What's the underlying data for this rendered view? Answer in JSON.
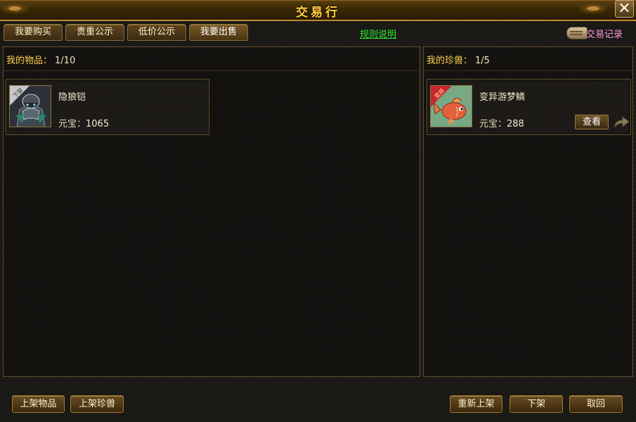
{
  "window": {
    "title": "交易行",
    "close_glyph": "✕"
  },
  "tabs": [
    {
      "label": "我要购买"
    },
    {
      "label": "贵重公示"
    },
    {
      "label": "低价公示"
    },
    {
      "label": "我要出售"
    }
  ],
  "rules_link": "规则说明",
  "trade_record": "交易记录",
  "left_panel": {
    "header_label": "我的物品：",
    "count": "1/10",
    "items": [
      {
        "name": "隐狼铠",
        "price_label": "元宝：",
        "price": "1065",
        "icon": "armor-icon",
        "ribbon_text": "下架"
      }
    ]
  },
  "right_panel": {
    "header_label": "我的珍兽：",
    "count": "1/5",
    "items": [
      {
        "name": "变异游梦鳞",
        "price_label": "元宝：",
        "price": "288",
        "icon": "fish-pet-icon",
        "ribbon_text": "变异",
        "view_label": "查看"
      }
    ]
  },
  "bottom_left_buttons": [
    {
      "label": "上架物品"
    },
    {
      "label": "上架珍兽"
    }
  ],
  "bottom_right_buttons": [
    {
      "label": "重新上架"
    },
    {
      "label": "下架"
    },
    {
      "label": "取回"
    }
  ],
  "colors": {
    "title": "#ffcf3a",
    "header": "#ffd24a",
    "link": "#2ee82e",
    "record": "#ff9ad8",
    "accent_border": "#c08a2a"
  }
}
